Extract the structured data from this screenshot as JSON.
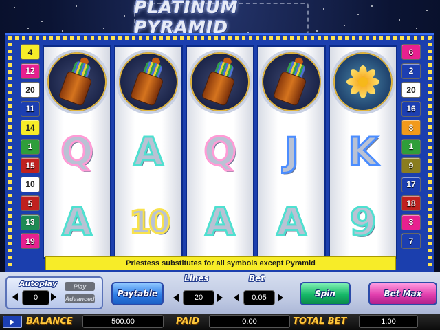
{
  "title": "PLATINUM PYRAMID",
  "left_lines": [
    {
      "label": "4",
      "color": "#f7ec28",
      "text": "#222"
    },
    {
      "label": "12",
      "color": "#e8208f",
      "text": "#fff"
    },
    {
      "label": "20",
      "color": "#ffffff",
      "text": "#222"
    },
    {
      "label": "11",
      "color": "#1c3fb2",
      "text": "#fff"
    },
    {
      "label": "14",
      "color": "#f7ec28",
      "text": "#222"
    },
    {
      "label": "1",
      "color": "#2f9e3a",
      "text": "#fff"
    },
    {
      "label": "15",
      "color": "#c0211f",
      "text": "#fff"
    },
    {
      "label": "10",
      "color": "#ffffff",
      "text": "#222"
    },
    {
      "label": "5",
      "color": "#c0211f",
      "text": "#fff"
    },
    {
      "label": "13",
      "color": "#1e8a54",
      "text": "#fff"
    },
    {
      "label": "19",
      "color": "#e8208f",
      "text": "#fff"
    }
  ],
  "right_lines": [
    {
      "label": "6",
      "color": "#e8208f",
      "text": "#fff"
    },
    {
      "label": "2",
      "color": "#1c3fb2",
      "text": "#fff"
    },
    {
      "label": "20",
      "color": "#ffffff",
      "text": "#222"
    },
    {
      "label": "16",
      "color": "#1c3fb2",
      "text": "#fff"
    },
    {
      "label": "8",
      "color": "#f29a1c",
      "text": "#fff"
    },
    {
      "label": "1",
      "color": "#2f9e3a",
      "text": "#fff"
    },
    {
      "label": "9",
      "color": "#8a7d1e",
      "text": "#fff"
    },
    {
      "label": "17",
      "color": "#1c3fb2",
      "text": "#fff"
    },
    {
      "label": "18",
      "color": "#c0211f",
      "text": "#fff"
    },
    {
      "label": "3",
      "color": "#e8208f",
      "text": "#fff"
    },
    {
      "label": "7",
      "color": "#1c3fb2",
      "text": "#fff"
    }
  ],
  "reels": [
    [
      {
        "symbol": "urn-icon"
      },
      {
        "symbol": "letter",
        "text": "Q",
        "style": "pink"
      },
      {
        "symbol": "letter",
        "text": "A",
        "style": "teal"
      }
    ],
    [
      {
        "symbol": "urn-icon"
      },
      {
        "symbol": "letter",
        "text": "A",
        "style": "teal"
      },
      {
        "symbol": "letter",
        "text": "10",
        "style": "yellow"
      }
    ],
    [
      {
        "symbol": "urn-icon"
      },
      {
        "symbol": "letter",
        "text": "Q",
        "style": "pink"
      },
      {
        "symbol": "letter",
        "text": "A",
        "style": "teal"
      }
    ],
    [
      {
        "symbol": "urn-icon"
      },
      {
        "symbol": "letter",
        "text": "J",
        "style": "blue"
      },
      {
        "symbol": "letter",
        "text": "A",
        "style": "teal"
      }
    ],
    [
      {
        "symbol": "lotus-icon"
      },
      {
        "symbol": "letter",
        "text": "K",
        "style": "blue"
      },
      {
        "symbol": "letter",
        "text": "9",
        "style": "teal"
      }
    ]
  ],
  "info_text": "Priestess substitutes for all symbols except Pyramid",
  "controls": {
    "autoplay_label": "Autoplay",
    "autoplay_value": "0",
    "play_label": "Play",
    "advanced_label": "Advanced",
    "paytable_label": "Paytable",
    "lines_label": "Lines",
    "lines_value": "20",
    "bet_label": "Bet",
    "bet_value": "0.05",
    "spin_label": "Spin",
    "betmax_label": "Bet Max"
  },
  "status": {
    "balance_label": "BALANCE",
    "balance_value": "500.00",
    "paid_label": "PAID",
    "paid_value": "0.00",
    "total_bet_label": "TOTAL BET",
    "total_bet_value": "1.00"
  }
}
